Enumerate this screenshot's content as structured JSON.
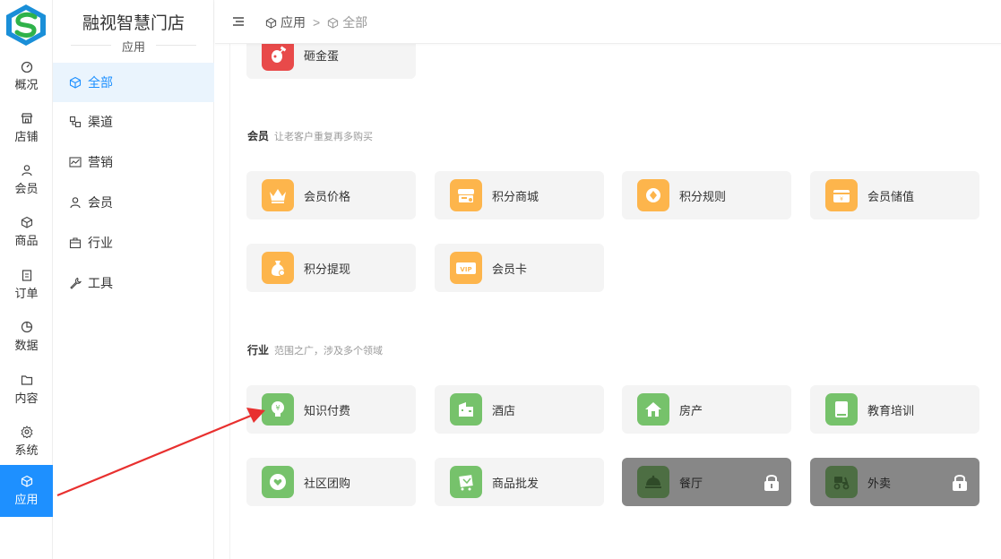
{
  "app": {
    "store_name": "融视智慧门店",
    "store_sub": "应用"
  },
  "rail": [
    {
      "label": "概况",
      "icon": "dashboard-icon"
    },
    {
      "label": "店铺",
      "icon": "store-icon"
    },
    {
      "label": "会员",
      "icon": "user-icon"
    },
    {
      "label": "商品",
      "icon": "cube-icon"
    },
    {
      "label": "订单",
      "icon": "clipboard-icon"
    },
    {
      "label": "数据",
      "icon": "pie-chart-icon"
    },
    {
      "label": "内容",
      "icon": "folder-icon"
    },
    {
      "label": "系统",
      "icon": "gear-icon"
    },
    {
      "label": "应用",
      "icon": "cube-icon",
      "active": true
    }
  ],
  "subnav": [
    {
      "label": "全部",
      "icon": "cube-icon",
      "active": true
    },
    {
      "label": "渠道",
      "icon": "channel-icon"
    },
    {
      "label": "营销",
      "icon": "trend-chart-icon"
    },
    {
      "label": "会员",
      "icon": "user-icon"
    },
    {
      "label": "行业",
      "icon": "briefcase-icon"
    },
    {
      "label": "工具",
      "icon": "wrench-icon"
    }
  ],
  "breadcrumb": {
    "root": "应用",
    "separator": ">",
    "current": "全部"
  },
  "sections": {
    "top_cards": [
      {
        "label": "砸金蛋",
        "color": "red",
        "icon": "golden-egg-icon"
      }
    ],
    "member": {
      "title": "会员",
      "desc": "让老客户重复再多购买",
      "cards": [
        {
          "label": "会员价格",
          "color": "gold",
          "icon": "crown-icon"
        },
        {
          "label": "积分商城",
          "color": "gold",
          "icon": "shop-icon"
        },
        {
          "label": "积分规则",
          "color": "gold",
          "icon": "diamond-coin-icon"
        },
        {
          "label": "会员储值",
          "color": "gold",
          "icon": "wallet-icon"
        },
        {
          "label": "积分提现",
          "color": "gold",
          "icon": "money-bag-icon"
        },
        {
          "label": "会员卡",
          "color": "gold",
          "icon": "vip-card-icon"
        }
      ]
    },
    "industry": {
      "title": "行业",
      "desc": "范围之广，涉及多个领域",
      "cards": [
        {
          "label": "知识付费",
          "color": "green",
          "icon": "lightbulb-yen-icon"
        },
        {
          "label": "酒店",
          "color": "green",
          "icon": "hotel-icon"
        },
        {
          "label": "房产",
          "color": "green",
          "icon": "house-icon"
        },
        {
          "label": "教育培训",
          "color": "green",
          "icon": "book-icon"
        },
        {
          "label": "社区团购",
          "color": "green",
          "icon": "heart-bubble-icon"
        },
        {
          "label": "商品批发",
          "color": "green",
          "icon": "cart-icon"
        },
        {
          "label": "餐厅",
          "color": "dark",
          "icon": "cloche-icon",
          "locked": true
        },
        {
          "label": "外卖",
          "color": "dark",
          "icon": "scooter-icon",
          "locked": true
        }
      ]
    }
  },
  "colors": {
    "accent": "#1e90ff",
    "gold": "#fdb54c",
    "green": "#76c26b",
    "red": "#e84a4a",
    "locked_bg": "#878787",
    "arrow": "#e8302f"
  }
}
